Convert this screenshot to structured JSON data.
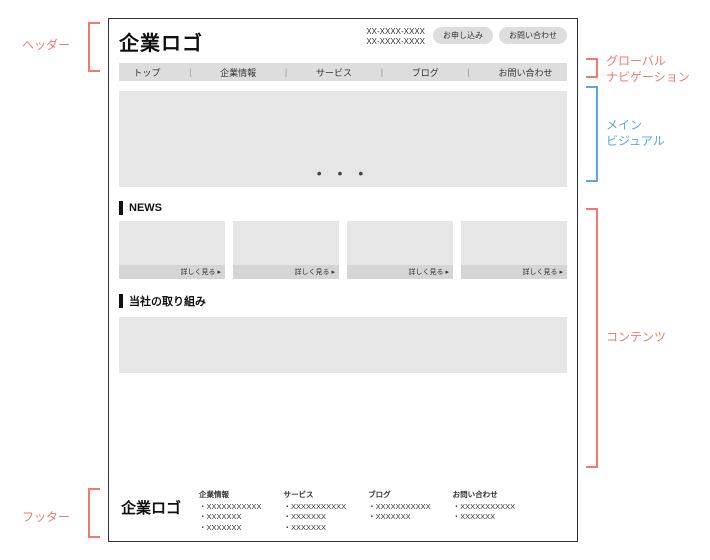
{
  "annotations": {
    "header": "ヘッダー",
    "gnav_line1": "グローバル",
    "gnav_line2": "ナビゲーション",
    "mv_line1": "メイン",
    "mv_line2": "ビジュアル",
    "contents": "コンテンツ",
    "footer": "フッター"
  },
  "header": {
    "logo": "企業ロゴ",
    "phone1": "XX-XXXX-XXXX",
    "phone2": "XX-XXXX-XXXX",
    "cta1": "お申し込み",
    "cta2": "お問い合わせ"
  },
  "gnav": {
    "items": [
      "トップ",
      "企業情報",
      "サービス",
      "ブログ",
      "お問い合わせ"
    ],
    "sep": "|"
  },
  "mv": {
    "dots": "• • •"
  },
  "news": {
    "heading": "NEWS",
    "more": "詳しく見る ▸"
  },
  "initiatives": {
    "heading": "当社の取り組み"
  },
  "footer": {
    "logo": "企業ロゴ",
    "cols": [
      {
        "h": "企業情報",
        "items": [
          "XXXXXXXXXXX",
          "XXXXXXX",
          "XXXXXXX"
        ]
      },
      {
        "h": "サービス",
        "items": [
          "XXXXXXXXXXX",
          "XXXXXXX",
          "XXXXXXX"
        ]
      },
      {
        "h": "ブログ",
        "items": [
          "XXXXXXXXXXX",
          "XXXXXXX"
        ]
      },
      {
        "h": "お問い合わせ",
        "items": [
          "XXXXXXXXXXX",
          "XXXXXXX"
        ]
      }
    ]
  }
}
